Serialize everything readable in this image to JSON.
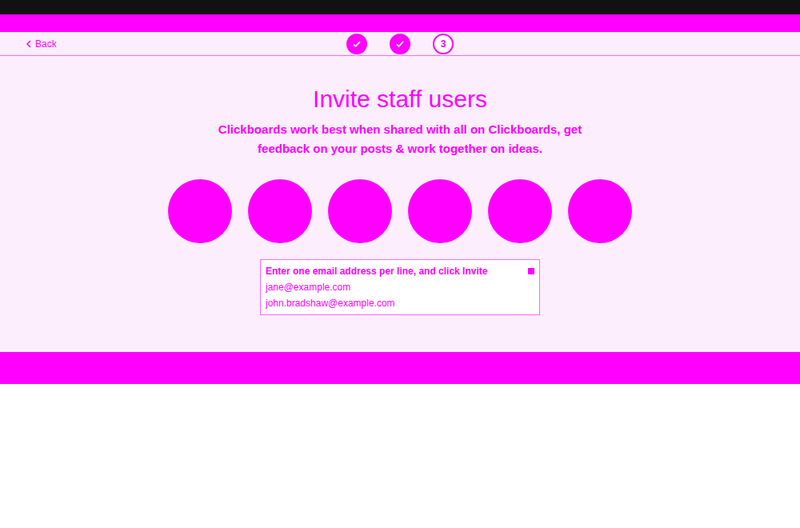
{
  "nav": {
    "back": "Back"
  },
  "steps": [
    {
      "completed": true,
      "current": false,
      "label": ""
    },
    {
      "completed": true,
      "current": false,
      "label": ""
    },
    {
      "completed": false,
      "current": true,
      "label": "3"
    }
  ],
  "title": "Invite staff users",
  "subtitle": [
    "Clickboards work best when shared with all on Clickboards, get",
    "feedback on your posts & work together on ideas."
  ],
  "avatars": [
    {
      "filled": true
    },
    {
      "filled": true
    },
    {
      "filled": true
    },
    {
      "filled": true
    },
    {
      "filled": true
    },
    {
      "filled": true
    }
  ],
  "email_field": {
    "hint": "Enter one email address per line, and click Invite",
    "lines": [
      "jane@example.com",
      "john.bradshaw@example.com"
    ]
  }
}
